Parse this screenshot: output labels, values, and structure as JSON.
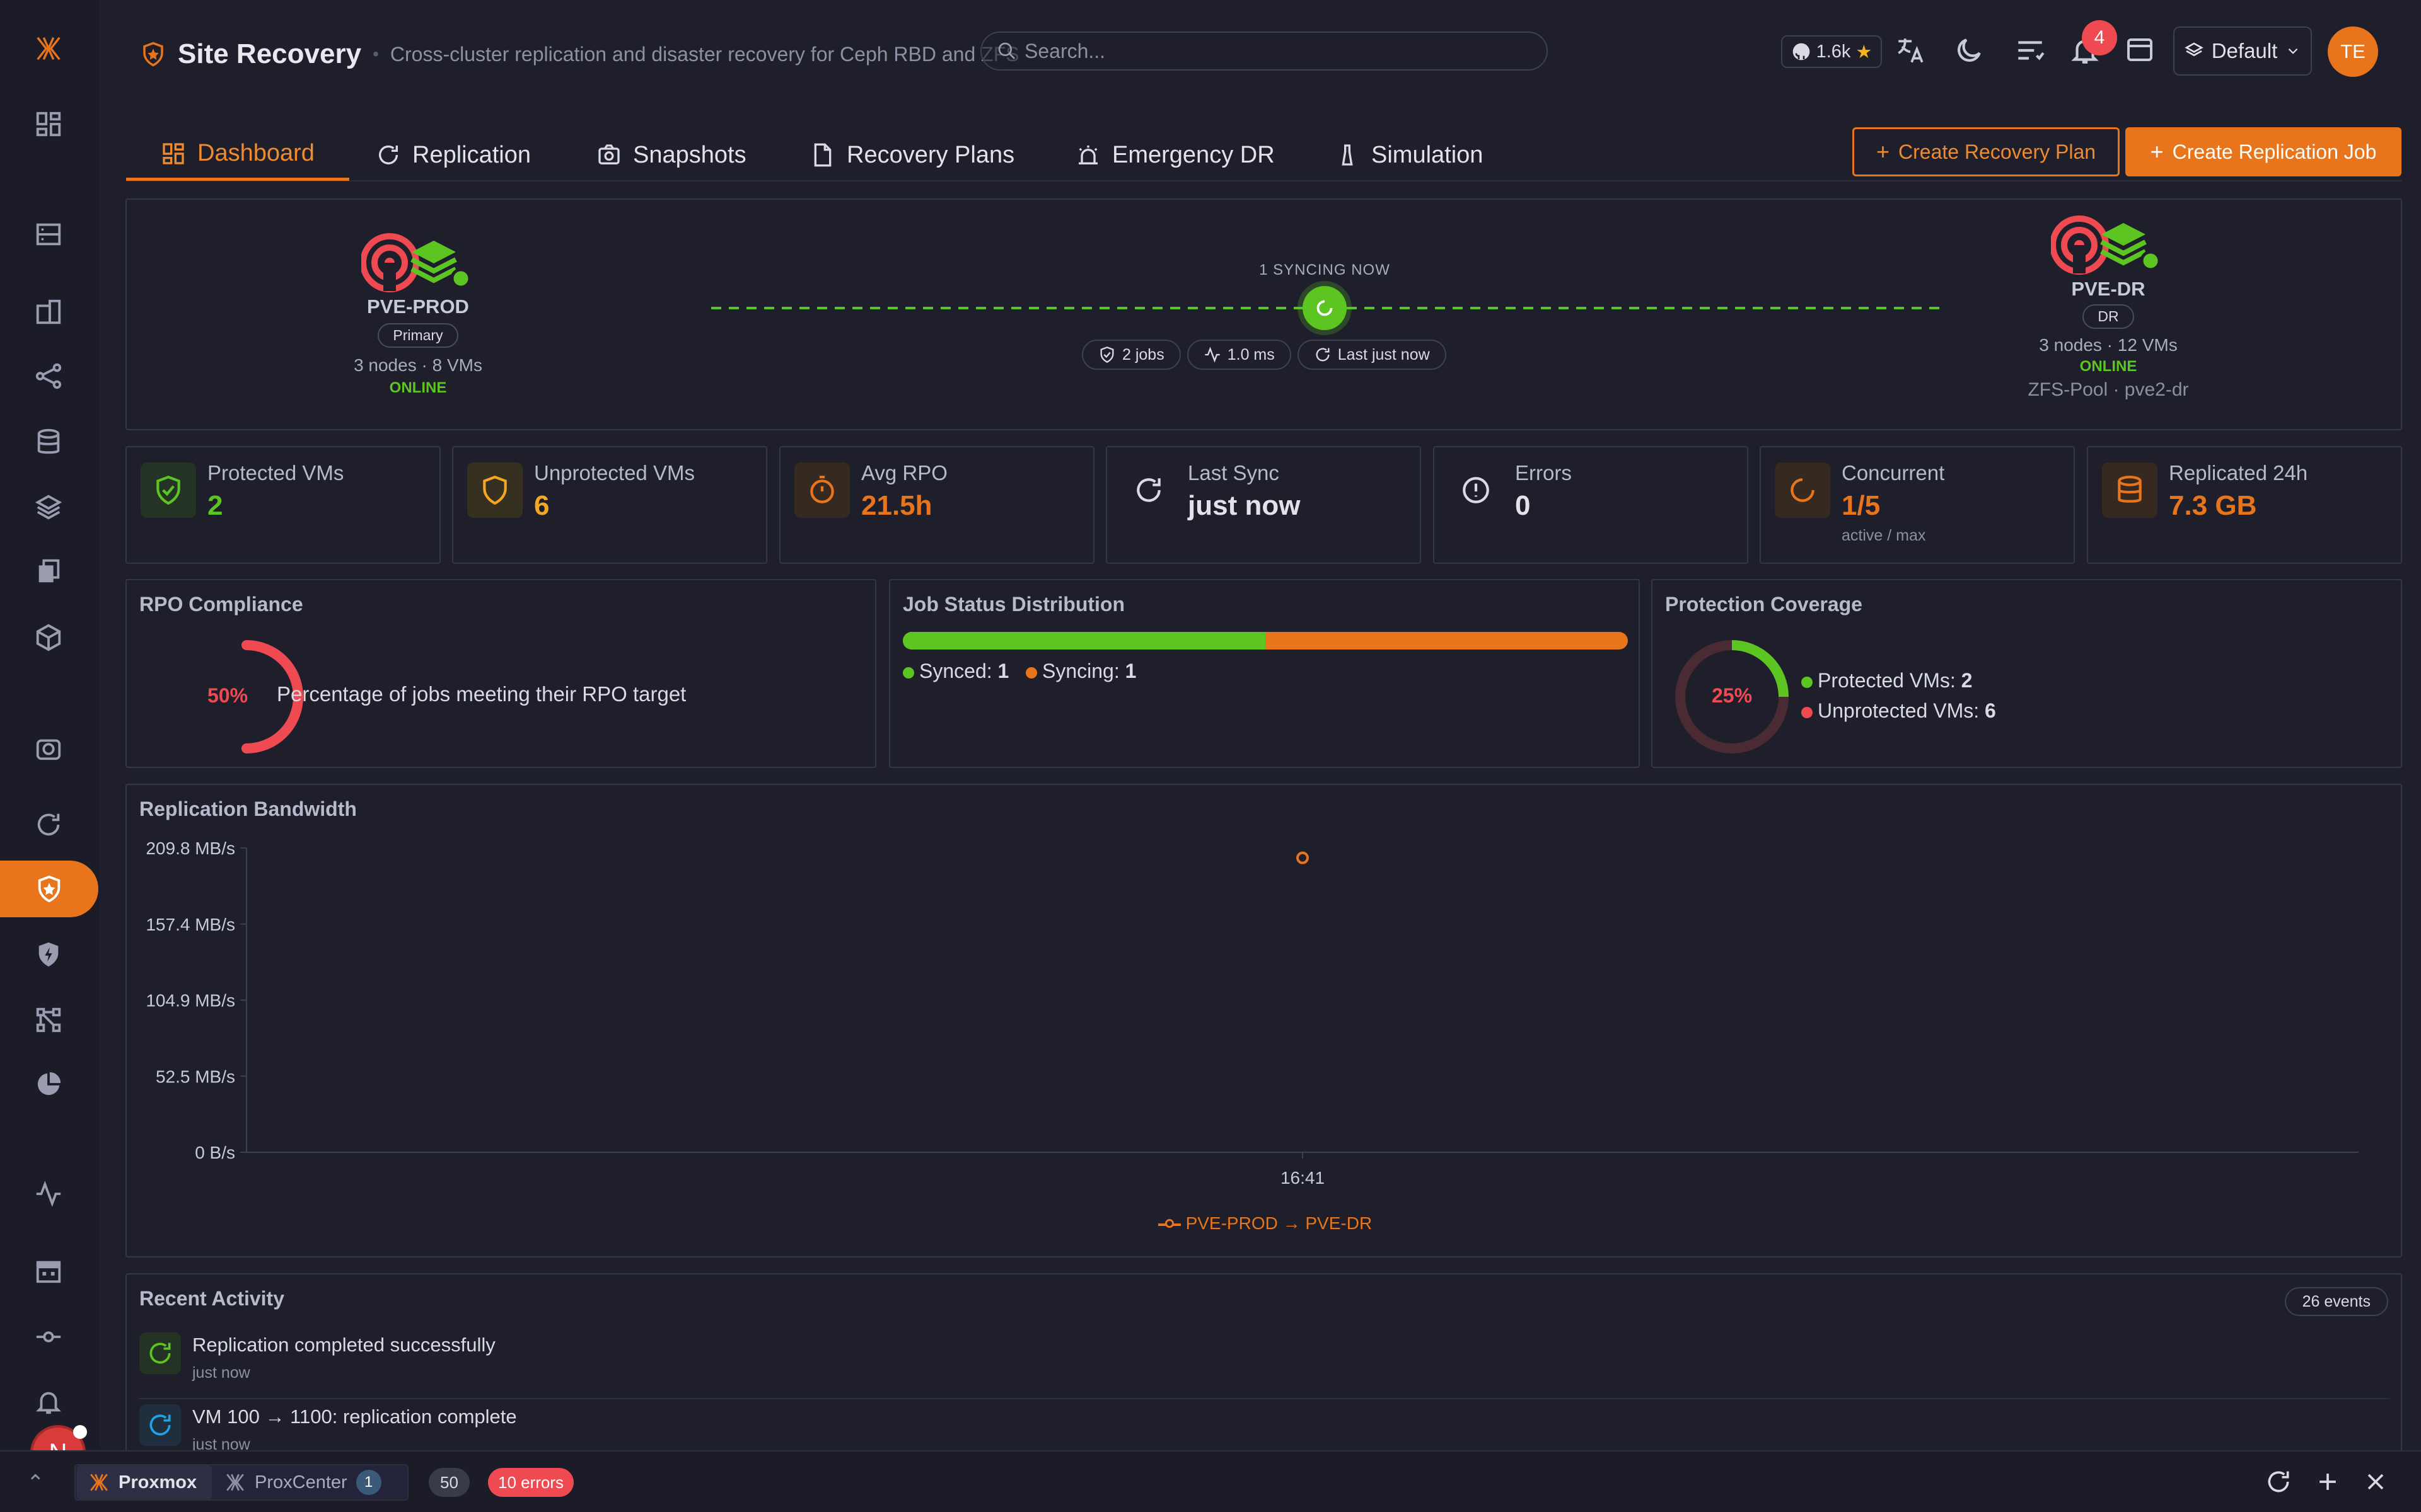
{
  "colors": {
    "accent": "#e8741b",
    "success": "#5cc521",
    "danger": "#ef4a52",
    "warning": "#e8741b",
    "info": "#1ea3e6"
  },
  "header": {
    "title": "Site Recovery",
    "subtitle": "Cross-cluster replication and disaster recovery for Ceph RBD and ZFS",
    "search_placeholder": "Search...",
    "github_stars": "1.6k",
    "notifications": "4",
    "workspace": "Default",
    "avatar": "TE"
  },
  "tabs": [
    {
      "label": "Dashboard",
      "icon": "dashboard-icon",
      "active": true
    },
    {
      "label": "Replication",
      "icon": "refresh-icon"
    },
    {
      "label": "Snapshots",
      "icon": "camera-icon"
    },
    {
      "label": "Recovery Plans",
      "icon": "document-icon"
    },
    {
      "label": "Emergency DR",
      "icon": "alarm-icon"
    },
    {
      "label": "Simulation",
      "icon": "flask-icon"
    }
  ],
  "actions": {
    "create_plan": "Create Recovery Plan",
    "create_job": "Create Replication Job"
  },
  "topology": {
    "source": {
      "name": "PVE-PROD",
      "role": "Primary",
      "meta": "3 nodes · 8 VMs",
      "status": "ONLINE"
    },
    "target": {
      "name": "PVE-DR",
      "role": "DR",
      "meta": "3 nodes · 12 VMs",
      "status": "ONLINE",
      "pool": "ZFS-Pool · pve2-dr"
    },
    "syncing": "1 SYNCING NOW",
    "jobs": "2 jobs",
    "latency": "1.0 ms",
    "last": "Last just now"
  },
  "stats": [
    {
      "label": "Protected VMs",
      "value": "2",
      "color": "#5cc521",
      "icon": "shield-check-icon"
    },
    {
      "label": "Unprotected VMs",
      "value": "6",
      "color": "#f5a623",
      "icon": "shield-icon"
    },
    {
      "label": "Avg RPO",
      "value": "21.5h",
      "color": "#e8741b",
      "icon": "timer-icon"
    },
    {
      "label": "Last Sync",
      "value": "just now",
      "color": "#e2e3ea",
      "icon": "sync-icon"
    },
    {
      "label": "Errors",
      "value": "0",
      "color": "#e2e3ea",
      "icon": "alert-circle-icon"
    },
    {
      "label": "Concurrent",
      "value": "1/5",
      "color": "#e8741b",
      "icon": "spinner-icon",
      "sub": "active / max"
    },
    {
      "label": "Replicated 24h",
      "value": "7.3 GB",
      "color": "#e8741b",
      "icon": "database-icon"
    }
  ],
  "rpo": {
    "title": "RPO Compliance",
    "percent": "50%",
    "fraction": 0.5,
    "desc": "Percentage of jobs meeting their RPO target"
  },
  "job_status": {
    "title": "Job Status Distribution",
    "synced_label": "Synced:",
    "synced": "1",
    "syncing_label": "Syncing:",
    "syncing": "1",
    "synced_fraction": 0.5
  },
  "coverage": {
    "title": "Protection Coverage",
    "percent": "25%",
    "fraction": 0.25,
    "protected_label": "Protected VMs:",
    "protected": "2",
    "unprotected_label": "Unprotected VMs:",
    "unprotected": "6"
  },
  "chart_data": {
    "type": "line",
    "title": "Replication Bandwidth",
    "y_ticks": [
      "209.8 MB/s",
      "157.4 MB/s",
      "104.9 MB/s",
      "52.5 MB/s",
      "0 B/s"
    ],
    "ylim": [
      0,
      209.8
    ],
    "x_ticks": [
      "16:41"
    ],
    "series": [
      {
        "name": "PVE-PROD → PVE-DR",
        "x": [
          "16:41"
        ],
        "values": [
          203
        ]
      }
    ]
  },
  "activity": {
    "title": "Recent Activity",
    "count": "26 events",
    "items": [
      {
        "text": "Replication completed successfully",
        "time": "just now",
        "color": "#5cc521"
      },
      {
        "text": "VM 100 → 1100: replication complete",
        "time": "just now",
        "color": "#1ea3e6"
      }
    ]
  },
  "taskbar": {
    "tab1": "Proxmox",
    "tab2": "ProxCenter",
    "tab2_badge": "1",
    "count": "50",
    "errors": "10 errors",
    "user_initial": "N"
  }
}
